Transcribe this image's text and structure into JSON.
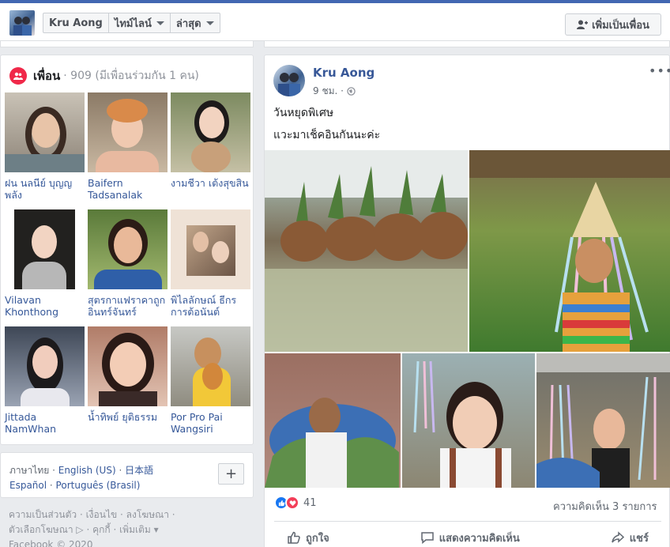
{
  "header": {
    "profile_name": "Kru Aong",
    "nav_timeline": "ไทม์ไลน์",
    "nav_latest": "ล่าสุด",
    "add_friend": "เพิ่มเป็นเพื่อน"
  },
  "friends": {
    "title": "เพื่อน",
    "count": "· 909 (มีเพื่อนร่วมกัน 1 คน)",
    "items": [
      {
        "name": "ฝน นลนีย์ บุญญพลัง"
      },
      {
        "name": "Baifern Tadsanalak"
      },
      {
        "name": "งามชีวา เต้งสุขสิน"
      },
      {
        "name": "Vilavan Khonthong"
      },
      {
        "name": "สุตรกาแฟราคาถูก อินทร์จันทร์"
      },
      {
        "name": "พิไลลักษณ์ ธีกรการต้อนันต์"
      },
      {
        "name": "Jittada NamWhan"
      },
      {
        "name": "น้ำทิพย์ ยุติธรรม"
      },
      {
        "name": "Por Pro Pai Wangsiri"
      }
    ]
  },
  "languages": {
    "current": "ภาษาไทย",
    "options": [
      "English (US)",
      "日本語",
      "Español",
      "Português (Brasil)"
    ],
    "add": "+"
  },
  "footer": {
    "line1": "ความเป็นส่วนตัว · เงื่อนไข · ลงโฆษณา ·",
    "line2": "ตัวเลือกโฆษณา ▷ · คุกกี้ · เพิ่มเติม ▾",
    "line3": "Facebook © 2020"
  },
  "post": {
    "author": "Kru Aong",
    "time": "9 ชม. ·",
    "text1": "วันหยุดพิเศษ",
    "text2": "แวะมาเช็คอินกันนะค่ะ",
    "reaction_count": "41",
    "comments": "ความคิดเห็น 3 รายการ",
    "more": "•••",
    "actions": {
      "like": "ถูกใจ",
      "comment": "แสดงความคิดเห็น",
      "share": "แชร์"
    }
  },
  "colors": {
    "brand": "#4267b2",
    "link": "#365899",
    "friends_icon": "#f02849"
  }
}
